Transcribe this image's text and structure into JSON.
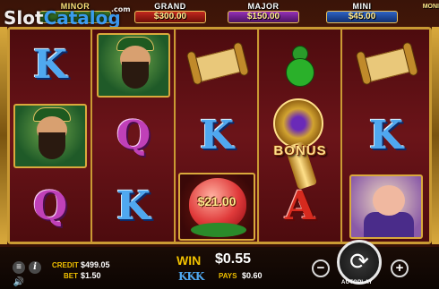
{
  "logo": {
    "text_slot": "Slot",
    "text_catalog": "Catalog",
    "text_com": ".com"
  },
  "jackpots": {
    "minor": {
      "title": "MINOR",
      "value": ""
    },
    "grand": {
      "title": "GRAND",
      "value": "$300.00"
    },
    "major": {
      "title": "MAJOR",
      "value": "$150.00"
    },
    "mini": {
      "title": "MINI",
      "value": "$45.00"
    },
    "extra_label": "MONI"
  },
  "reels": [
    [
      "K",
      "guan-yu-tile",
      "Q"
    ],
    [
      "guan-yu-tile",
      "Q",
      "K"
    ],
    [
      "scroll-icon",
      "K",
      "peach-bonus"
    ],
    [
      "gourd-icon",
      "bonus-scatter",
      "A"
    ],
    [
      "scroll-icon",
      "K",
      "pig-tile"
    ]
  ],
  "symbols": {
    "k": "K",
    "q": "Q",
    "a": "A"
  },
  "bonus": {
    "label": "BONUS"
  },
  "peach": {
    "value": "$21.00"
  },
  "bottom": {
    "credit_label": "CREDIT",
    "credit_value": "$499.05",
    "bet_label": "BET",
    "bet_value": "$1.50",
    "win_label": "WIN",
    "win_value": "$0.55",
    "pay_symbols": "KKK",
    "pays_label": "PAYS",
    "pays_value": "$0.60",
    "autoplay_label": "AUTOPLAY",
    "minus": "−",
    "plus": "+",
    "menu_icon": "≡",
    "info_icon": "i",
    "speaker_icon": "🔊",
    "spin_icon": "⟳"
  },
  "colors": {
    "gold": "#d9a93c",
    "k_blue": "#4fa8f0",
    "q_purple": "#c040b8",
    "a_red": "#d62a1e",
    "label_yellow": "#f0c000"
  }
}
